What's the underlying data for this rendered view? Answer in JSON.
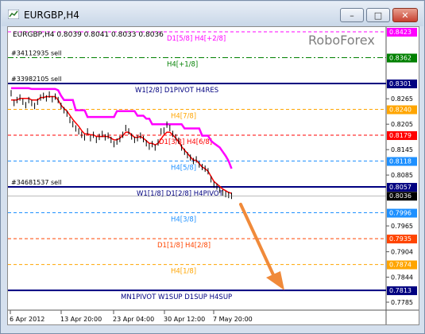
{
  "window": {
    "title": "EURGBP,H4",
    "buttons": {
      "minimize": "–",
      "maximize": "□",
      "close": "✕"
    }
  },
  "chart": {
    "header": "EURGBP,H4  0.8039 0.8041 0.8033 0.8036",
    "watermark": "RoboForex"
  },
  "chart_data": {
    "type": "line",
    "title": "",
    "symbol": "EURGBP",
    "timeframe": "H4",
    "ohlc": {
      "open": 0.8039,
      "high": 0.8041,
      "low": 0.8033,
      "close": 0.8036
    },
    "ylim": [
      0.7785,
      0.8425
    ],
    "y_ticks": [
      "0.8423",
      "0.8362",
      "0.8301",
      "0.8265",
      "0.8240",
      "0.8205",
      "0.8179",
      "0.8145",
      "0.8118",
      "0.8085",
      "0.8057",
      "0.8036",
      "0.7996",
      "0.7965",
      "0.7935",
      "0.7904",
      "0.7874",
      "0.7844",
      "0.7813",
      "0.7785"
    ],
    "x_ticks": [
      "6 Apr 2012",
      "13 Apr 20:00",
      "23 Apr 04:00",
      "30 Apr 12:00",
      "7 May 20:00"
    ],
    "orders": [
      {
        "label": "#34112935 sell",
        "price": 0.8362
      },
      {
        "label": "#33982105 sell",
        "price": 0.8301
      },
      {
        "label": "#34681537 sell",
        "price": 0.8057
      }
    ],
    "levels": [
      {
        "label": "D1[5/8] H4[+2/8]",
        "price": 0.8423,
        "color": "#ff00ff",
        "style": "dash"
      },
      {
        "label": "H4[+1/8]",
        "price": 0.8362,
        "color": "#008000",
        "style": "dashdot"
      },
      {
        "label": "W1[2/8] D1PIVOT H4RES",
        "price": 0.8301,
        "color": "#000080",
        "style": "solid"
      },
      {
        "label": "H4[7/8]",
        "price": 0.824,
        "color": "#ffa500",
        "style": "dash"
      },
      {
        "label": "D1[3/8] H4[6/8]",
        "price": 0.8179,
        "color": "#ff0000",
        "style": "dash"
      },
      {
        "label": "H4[5/8]",
        "price": 0.8118,
        "color": "#1e90ff",
        "style": "dash"
      },
      {
        "label": "W1[1/8] D1[2/8] H4PIVOT",
        "price": 0.8057,
        "color": "#000080",
        "style": "solid"
      },
      {
        "label": "H4[3/8]",
        "price": 0.7996,
        "color": "#1e90ff",
        "style": "dash"
      },
      {
        "label": "D1[1/8] H4[2/8]",
        "price": 0.7935,
        "color": "#ff4500",
        "style": "dash"
      },
      {
        "label": "H4[1/8]",
        "price": 0.7874,
        "color": "#ffa500",
        "style": "dash"
      },
      {
        "label": "MN1PIVOT W1SUP D1SUP H4SUP",
        "price": 0.7813,
        "color": "#000080",
        "style": "solid"
      }
    ],
    "price_series": [
      0.8278,
      0.8255,
      0.8262,
      0.8268,
      0.8258,
      0.825,
      0.8262,
      0.8255,
      0.8248,
      0.8258,
      0.8268,
      0.8272,
      0.8266,
      0.8275,
      0.8264,
      0.827,
      0.8262,
      0.8248,
      0.8238,
      0.823,
      0.8215,
      0.8205,
      0.8195,
      0.8188,
      0.818,
      0.8174,
      0.8188,
      0.8172,
      0.818,
      0.8168,
      0.8175,
      0.8182,
      0.8174,
      0.8178,
      0.8168,
      0.8158,
      0.8164,
      0.817,
      0.818,
      0.8196,
      0.8188,
      0.8176,
      0.8168,
      0.8172,
      0.8178,
      0.817,
      0.816,
      0.8152,
      0.8158,
      0.815,
      0.8162,
      0.8188,
      0.819,
      0.8204,
      0.8196,
      0.8182,
      0.8174,
      0.8166,
      0.815,
      0.814,
      0.8132,
      0.8126,
      0.8118,
      0.8122,
      0.811,
      0.8104,
      0.81,
      0.8094,
      0.8075,
      0.8062,
      0.8058,
      0.805,
      0.8043,
      0.804,
      0.8038,
      0.8036
    ],
    "red_series": [
      0.8262,
      0.8262,
      0.8262,
      0.8266,
      0.8266,
      0.8266,
      0.8266,
      0.8262,
      0.8262,
      0.8262,
      0.8268,
      0.8268,
      0.827,
      0.827,
      0.827,
      0.827,
      0.8262,
      0.825,
      0.8242,
      0.8236,
      0.8226,
      0.8216,
      0.8208,
      0.82,
      0.819,
      0.8182,
      0.8182,
      0.818,
      0.818,
      0.8176,
      0.8176,
      0.8176,
      0.8176,
      0.8176,
      0.8172,
      0.8168,
      0.8168,
      0.8172,
      0.8178,
      0.8186,
      0.8186,
      0.818,
      0.8174,
      0.8174,
      0.8176,
      0.8172,
      0.8166,
      0.816,
      0.816,
      0.8156,
      0.816,
      0.817,
      0.818,
      0.8186,
      0.8186,
      0.818,
      0.8172,
      0.8164,
      0.8152,
      0.8144,
      0.8136,
      0.8128,
      0.812,
      0.812,
      0.8112,
      0.8104,
      0.81,
      0.8094,
      0.8082,
      0.807,
      0.8064,
      0.8058,
      0.8052,
      0.8048,
      0.8044,
      0.8042
    ],
    "magenta_series": [
      0.829,
      0.829,
      0.829,
      0.829,
      0.829,
      0.829,
      0.829,
      0.8288,
      0.8288,
      0.8288,
      0.8288,
      0.8288,
      0.8288,
      0.8288,
      0.8288,
      0.8288,
      0.8285,
      0.8272,
      0.8262,
      0.8262,
      0.8262,
      0.8262,
      0.8238,
      0.8238,
      0.8238,
      0.8238,
      0.8222,
      0.8222,
      0.8222,
      0.8222,
      0.8222,
      0.8222,
      0.8222,
      0.8222,
      0.8222,
      0.8222,
      0.8236,
      0.8236,
      0.8236,
      0.8236,
      0.8236,
      0.8236,
      0.8236,
      0.8225,
      0.8225,
      0.8225,
      0.8218,
      0.8218,
      0.8205,
      0.8205,
      0.8205,
      0.8205,
      0.8205,
      0.8205,
      0.8205,
      0.8205,
      0.8205,
      0.8205,
      0.8205,
      0.8195,
      0.8195,
      0.8195,
      0.8195,
      0.8195,
      0.8195,
      0.8178,
      0.8178,
      0.8178,
      0.8166,
      0.816,
      0.8155,
      0.815,
      0.814,
      0.813,
      0.8118,
      0.81
    ]
  }
}
